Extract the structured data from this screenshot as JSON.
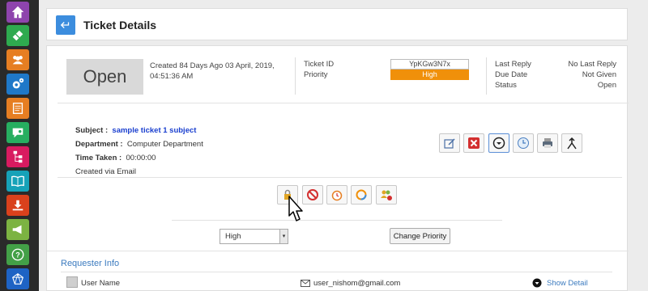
{
  "sidebar": {
    "items": [
      {
        "name": "home-icon",
        "color": "#8e44ad"
      },
      {
        "name": "ticket-icon",
        "color": "#2eaa4f"
      },
      {
        "name": "users-icon",
        "color": "#e67e22"
      },
      {
        "name": "settings-icon",
        "color": "#1f78c8"
      },
      {
        "name": "report-icon",
        "color": "#e67e22"
      },
      {
        "name": "chat-icon",
        "color": "#27ae60"
      },
      {
        "name": "sitemap-icon",
        "color": "#d81b60"
      },
      {
        "name": "book-icon",
        "color": "#16a2b8"
      },
      {
        "name": "download-icon",
        "color": "#d9411c"
      },
      {
        "name": "megaphone-icon",
        "color": "#7cb342"
      },
      {
        "name": "help-icon",
        "color": "#43a047"
      },
      {
        "name": "network-icon",
        "color": "#1e63c4"
      }
    ]
  },
  "header": {
    "title": "Ticket Details"
  },
  "ticket": {
    "status": "Open",
    "created_line1": "Created 84 Days Ago 03 April, 2019,",
    "created_line2": "04:51:36 AM",
    "ticket_id_label": "Ticket ID",
    "ticket_id": "YpKGw3N7x",
    "priority_label": "Priority",
    "priority": "High",
    "last_reply_label": "Last Reply",
    "last_reply": "No Last Reply",
    "due_date_label": "Due Date",
    "due_date": "Not Given",
    "status_label": "Status",
    "status_value": "Open"
  },
  "details": {
    "subject_label": "Subject :",
    "subject": "sample ticket 1 subject",
    "department_label": "Department :",
    "department": "Computer Department",
    "time_taken_label": "Time Taken :",
    "time_taken": "00:00:00",
    "created_via": "Created via Email"
  },
  "priority_form": {
    "selected": "High",
    "change_label": "Change Priority"
  },
  "requester": {
    "title": "Requester Info",
    "user_name": "User Name",
    "email": "user_nishom@gmail.com",
    "show_detail": "Show Detail"
  },
  "colors": {
    "accent": "#3c8dde",
    "priority_high": "#f0900a",
    "link": "#1a3fcf"
  }
}
